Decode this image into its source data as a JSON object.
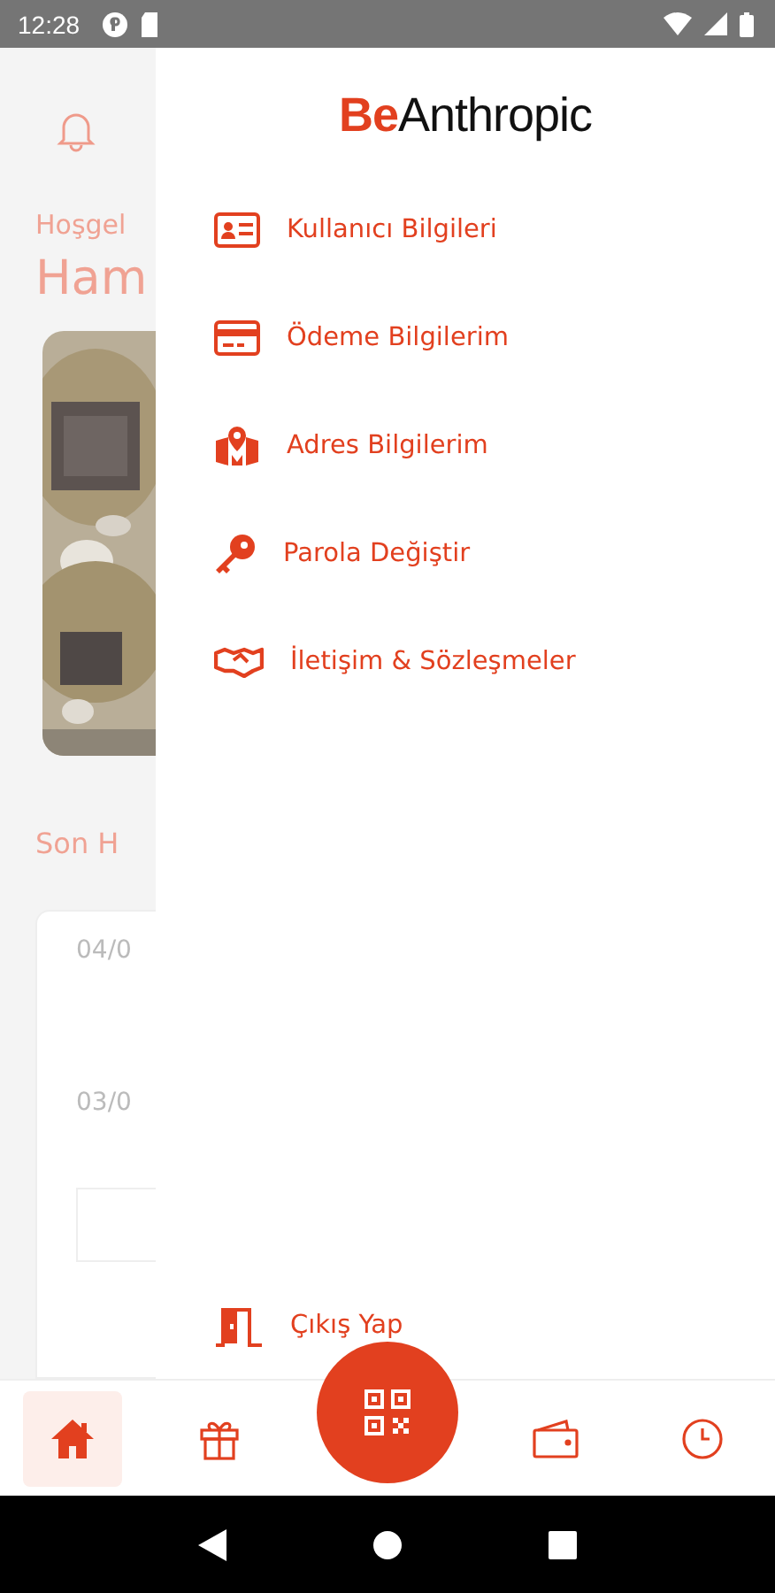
{
  "status_bar": {
    "time": "12:28"
  },
  "background": {
    "greeting": "Hoşgel",
    "name": "Ham",
    "section_title": "Son H",
    "dates": [
      "04/0",
      "03/0"
    ]
  },
  "drawer": {
    "logo": {
      "accent": "Be",
      "text": "Anthropic"
    },
    "items": [
      {
        "kind": "user-card",
        "label": "Kullanıcı Bilgileri"
      },
      {
        "kind": "payment",
        "label": "Ödeme Bilgilerim"
      },
      {
        "kind": "address",
        "label": "Adres Bilgilerim"
      },
      {
        "kind": "password",
        "label": "Parola Değiştir"
      },
      {
        "kind": "contracts",
        "label": "İletişim & Sözleşmeler"
      }
    ],
    "logout": {
      "label": "Çıkış Yap"
    }
  },
  "bottom_nav": [
    {
      "kind": "home",
      "selected": true
    },
    {
      "kind": "gift",
      "selected": false
    },
    {
      "kind": "qr",
      "selected": false
    },
    {
      "kind": "wallet",
      "selected": false
    },
    {
      "kind": "history",
      "selected": false
    }
  ]
}
